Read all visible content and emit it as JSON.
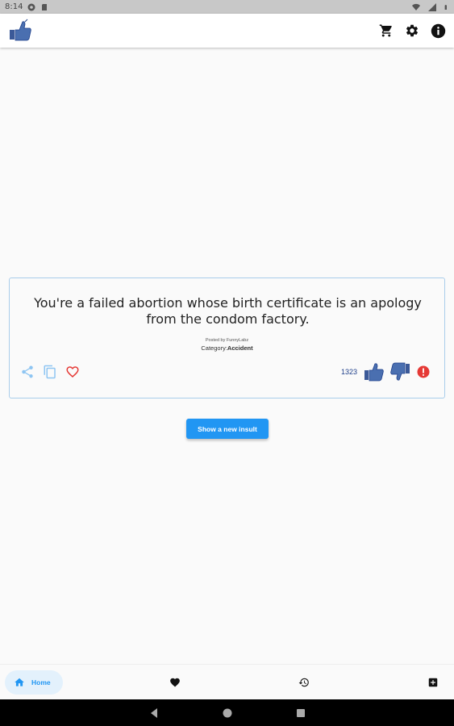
{
  "status_bar": {
    "time": "8:14",
    "icons": [
      "settings-status-icon",
      "sd-card-icon",
      "wifi-icon",
      "signal-icon",
      "battery-icon"
    ]
  },
  "app_bar": {
    "logo": "thumbs-up-logo",
    "actions": [
      "cart-icon",
      "settings-icon",
      "info-icon"
    ]
  },
  "insult_card": {
    "text": "You're a failed abortion whose birth certificate is an apology from the condom factory.",
    "posted_by": "Posted by FunnyLabz",
    "category_label": "Category:",
    "category_value": "Accident",
    "vote_count": "1323",
    "actions_left": [
      "share-icon",
      "copy-icon",
      "heart-outline-icon"
    ],
    "actions_right": [
      "thumbs-up-icon",
      "thumbs-down-icon",
      "report-icon"
    ]
  },
  "new_insult_button": {
    "label": "Show a new insult"
  },
  "bottom_nav": {
    "items": [
      {
        "label": "Home",
        "icon": "home-icon",
        "active": true
      },
      {
        "label": "",
        "icon": "heart-icon",
        "active": false
      },
      {
        "label": "",
        "icon": "history-icon",
        "active": false
      },
      {
        "label": "",
        "icon": "add-box-icon",
        "active": false
      }
    ]
  },
  "colors": {
    "accent": "#2196f3",
    "card_border": "#a9cdea",
    "thumb": "#3b5998",
    "report": "#e53935",
    "heart_outline": "#e53935"
  }
}
